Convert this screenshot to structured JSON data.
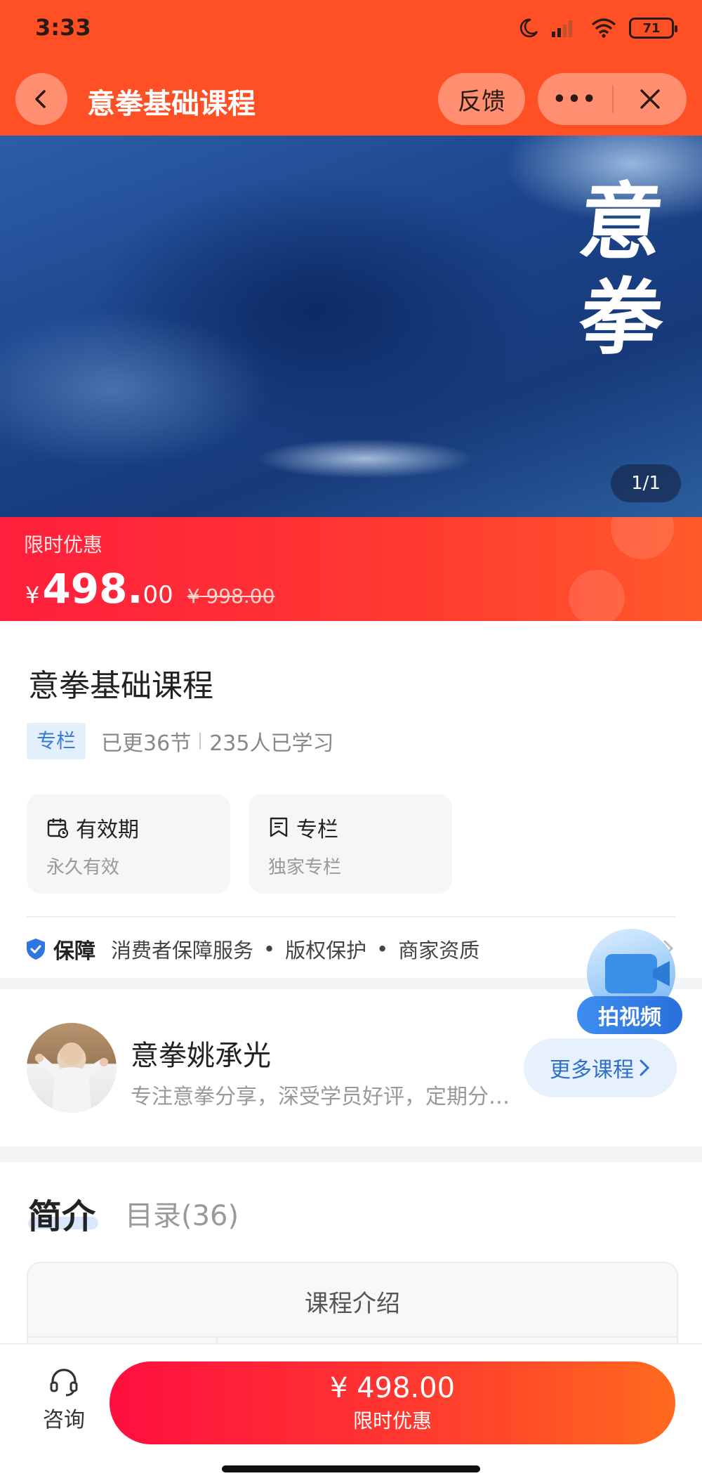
{
  "status_bar": {
    "time": "3:33",
    "battery": "71",
    "icons": [
      "moon-icon",
      "signal-icon",
      "wifi-icon",
      "battery-icon"
    ]
  },
  "header": {
    "title": "意拳基础课程",
    "feedback_label": "反馈",
    "more_label": "•••",
    "bg_color": "#ff4f24",
    "icons": [
      "back-icon",
      "more-icon",
      "close-icon"
    ]
  },
  "banner": {
    "calligraphy": [
      "意",
      "拳"
    ],
    "pager": "1/1"
  },
  "price": {
    "promo_label": "限时优惠",
    "currency": "¥",
    "integer": "498.",
    "decimal": "00",
    "original": "¥ 998.00"
  },
  "course": {
    "title": "意拳基础课程",
    "tag": "专栏",
    "updated": "已更36节",
    "learners": "235人已学习",
    "cards": [
      {
        "title": "有效期",
        "sub": "永久有效",
        "icon": "calendar-icon"
      },
      {
        "title": "专栏",
        "sub": "独家专栏",
        "icon": "bookmark-icon"
      }
    ]
  },
  "guarantee": {
    "title": "保障",
    "items": [
      "消费者保障服务",
      "版权保护",
      "商家资质"
    ],
    "separator": "•",
    "icon": "shield-check-icon"
  },
  "video_widget": {
    "label": "拍视频"
  },
  "author": {
    "name": "意拳姚承光",
    "desc": "专注意拳分享，深受学员好评，定期分…",
    "more_courses": "更多课程"
  },
  "tabs": {
    "intro": "简介",
    "catalog": "目录(36)"
  },
  "intro_box": {
    "title": "课程介绍"
  },
  "bottom_bar": {
    "consult_label": "咨询",
    "buy_price": "¥ 498.00",
    "buy_label": "限时优惠",
    "accent": "#ff1f3d"
  }
}
